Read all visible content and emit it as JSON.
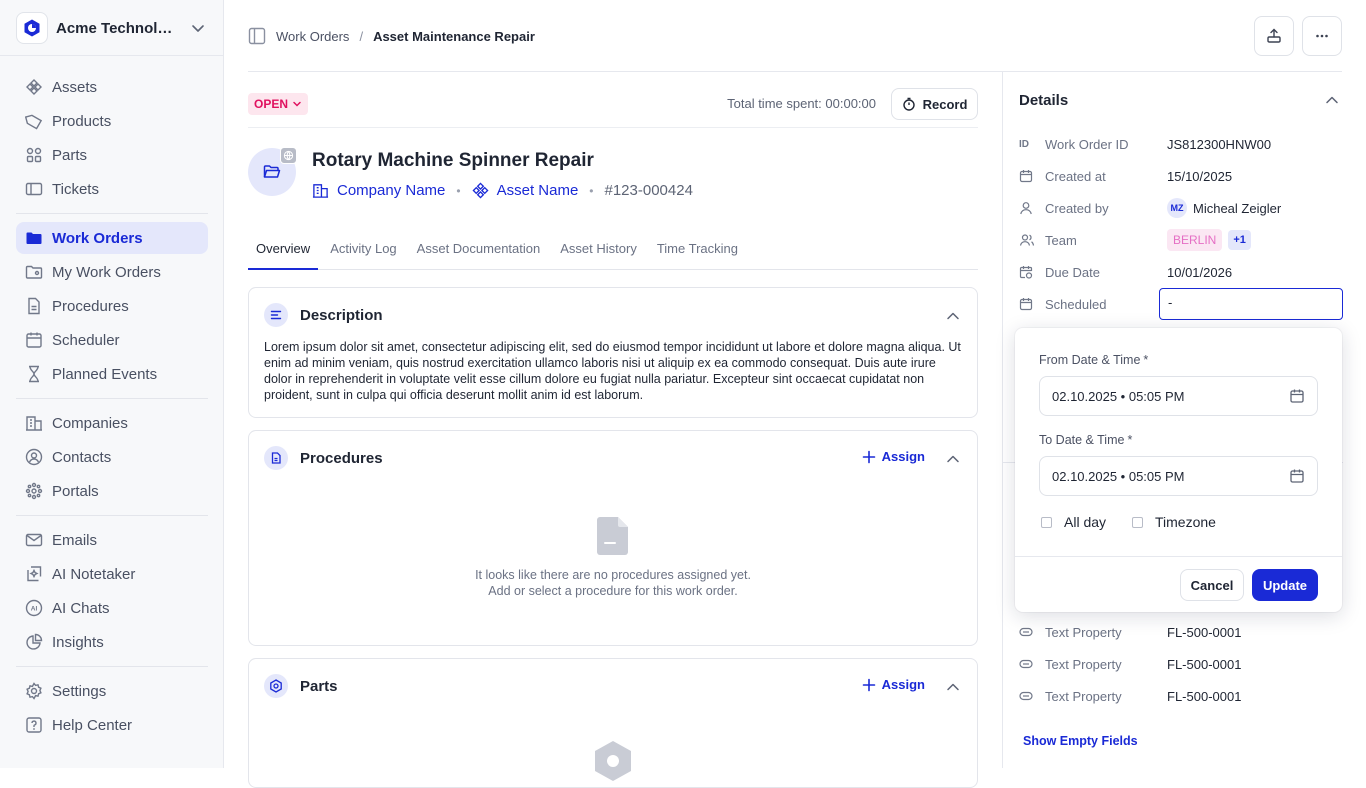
{
  "org": {
    "name": "Acme Technologies"
  },
  "nav": {
    "group1": [
      "Assets",
      "Products",
      "Parts",
      "Tickets"
    ],
    "group2": [
      "Work Orders",
      "My Work Orders",
      "Procedures",
      "Scheduler",
      "Planned Events"
    ],
    "group3": [
      "Companies",
      "Contacts",
      "Portals"
    ],
    "group4": [
      "Emails",
      "AI Notetaker",
      "AI Chats",
      "Insights"
    ],
    "group5": [
      "Settings",
      "Help Center"
    ]
  },
  "breadcrumb": {
    "parent": "Work Orders",
    "separator": "/",
    "current": "Asset Maintenance Repair"
  },
  "status": {
    "label": "OPEN",
    "total_time": "Total time spent: 00:00:00",
    "record_label": "Record"
  },
  "work_order": {
    "title": "Rotary Machine Spinner Repair",
    "company": "Company Name",
    "asset": "Asset Name",
    "id": "#123-000424"
  },
  "tabs": [
    "Overview",
    "Activity Log",
    "Asset Documentation",
    "Asset History",
    "Time Tracking"
  ],
  "description": {
    "title": "Description",
    "text": "Lorem ipsum dolor sit amet, consectetur adipiscing elit, sed do eiusmod tempor incididunt ut labore et dolore magna aliqua. Ut enim ad minim veniam, quis nostrud exercitation ullamco laboris nisi ut aliquip ex ea commodo consequat. Duis aute irure dolor in reprehenderit in voluptate velit esse cillum dolore eu fugiat nulla pariatur. Excepteur sint occaecat cupidatat non proident, sunt in culpa qui officia deserunt mollit anim id est laborum."
  },
  "procedures": {
    "title": "Procedures",
    "assign": "Assign",
    "empty_line1": "It looks like there are no procedures assigned yet.",
    "empty_line2": "Add or select a procedure for this work order."
  },
  "parts": {
    "title": "Parts",
    "assign": "Assign"
  },
  "details": {
    "title": "Details",
    "id_icon": "ID",
    "rows": [
      {
        "label": "Work Order ID",
        "value": "JS812300HNW00"
      },
      {
        "label": "Created at",
        "value": "15/10/2025"
      },
      {
        "label": "Created by",
        "value": "Micheal Zeigler",
        "initials": "MZ"
      },
      {
        "label": "Team",
        "value": "BERLIN",
        "extra": "+1"
      },
      {
        "label": "Due Date",
        "value": "10/01/2026"
      },
      {
        "label": "Scheduled",
        "value": "-"
      }
    ],
    "props": [
      {
        "label": "Text Property",
        "value": "FL-500-0001"
      },
      {
        "label": "Text Property",
        "value": "FL-500-0001"
      },
      {
        "label": "Text Property",
        "value": "FL-500-0001"
      }
    ],
    "show_empty": "Show Empty Fields"
  },
  "schedule_popover": {
    "from_label": "From Date & Time",
    "from_value": "02.10.2025 • 05:05 PM",
    "to_label": "To Date & Time",
    "to_value": "02.10.2025 • 05:05 PM",
    "required_mark": "*",
    "all_day": "All day",
    "timezone": "Timezone",
    "cancel": "Cancel",
    "update": "Update"
  },
  "colors": {
    "accent": "#1a2ad6",
    "open_badge_bg": "#fde6ee",
    "open_badge_text": "#e0115f",
    "team_badge": "#e56fc4"
  }
}
